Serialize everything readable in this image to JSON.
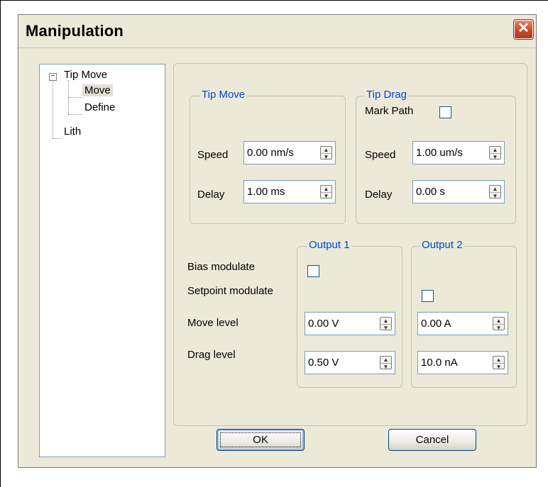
{
  "window": {
    "title": "Manipulation",
    "close_glyph": "✕"
  },
  "tree": {
    "root_label": "Tip Move",
    "root_expander": "−",
    "children": [
      "Move",
      "Define"
    ],
    "other": "Lith"
  },
  "tip_move": {
    "legend": "Tip Move",
    "speed_label": "Speed",
    "speed_value": "0.00 nm/s",
    "delay_label": "Delay",
    "delay_value": "1.00 ms"
  },
  "tip_drag": {
    "legend": "Tip Drag",
    "mark_path_label": "Mark Path",
    "speed_label": "Speed",
    "speed_value": "1.00 um/s",
    "delay_label": "Delay",
    "delay_value": "0.00 s"
  },
  "outputs": {
    "output1_legend": "Output 1",
    "output2_legend": "Output 2",
    "bias_modulate_label": "Bias modulate",
    "setpoint_modulate_label": "Setpoint modulate",
    "move_level_label": "Move level",
    "drag_level_label": "Drag level",
    "output1_move_value": "0.00 V",
    "output1_drag_value": "0.50 V",
    "output2_move_value": "0.00 A",
    "output2_drag_value": "10.0 nA"
  },
  "buttons": {
    "ok": "OK",
    "cancel": "Cancel"
  },
  "spin_up": "▲",
  "spin_down": "▼",
  "colors": {
    "legend_text": "#0046d5",
    "dialog_bg": "#ece9d8",
    "close_button": "#c94a2d"
  }
}
